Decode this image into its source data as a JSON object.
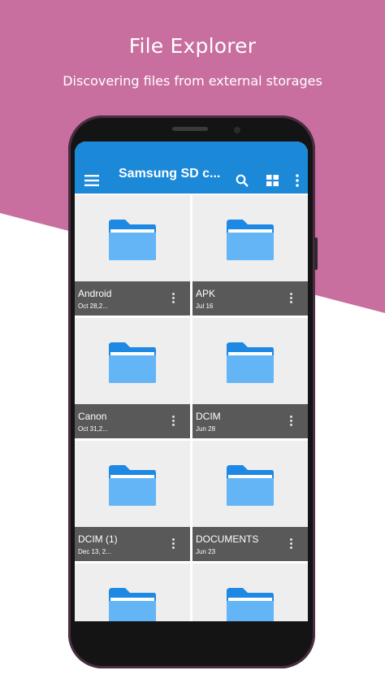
{
  "header": {
    "title": "File Explorer",
    "subtitle": "Discovering files from external storages"
  },
  "colors": {
    "background_accent": "#c96fa0",
    "appbar": "#1b88d8",
    "folder_back": "#1e88e5",
    "folder_front": "#64b5f6",
    "caption_bar": "#595959"
  },
  "appbar": {
    "title": "Samsung SD c...",
    "icons": [
      "menu-icon",
      "search-icon",
      "grid-view-icon",
      "more-vert-icon"
    ]
  },
  "files": [
    {
      "name": "Android",
      "date": "Oct 28,2..."
    },
    {
      "name": "APK",
      "date": "Jul 16"
    },
    {
      "name": "Canon",
      "date": "Oct 31,2..."
    },
    {
      "name": "DCIM",
      "date": "Jun 28"
    },
    {
      "name": "DCIM (1)",
      "date": "Dec 13, 2..."
    },
    {
      "name": "DOCUMENTS",
      "date": "Jun 23"
    },
    {
      "name": "",
      "date": ""
    },
    {
      "name": "",
      "date": ""
    }
  ]
}
